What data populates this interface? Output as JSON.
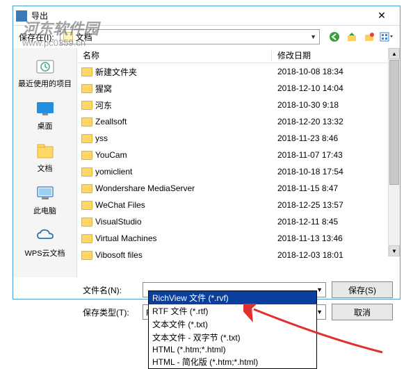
{
  "title": "导出",
  "watermark": {
    "big": "河东软件园",
    "url": "www.pc0359.cn"
  },
  "savein": {
    "label": "保存在(I):",
    "value": "文档"
  },
  "columns": {
    "name": "名称",
    "date": "修改日期"
  },
  "files": [
    {
      "name": "新建文件夹",
      "date": "2018-10-08 18:34"
    },
    {
      "name": "猩窝",
      "date": "2018-12-10 14:04"
    },
    {
      "name": "河东",
      "date": "2018-10-30 9:18"
    },
    {
      "name": "Zeallsoft",
      "date": "2018-12-20 13:32"
    },
    {
      "name": "yss",
      "date": "2018-11-23 8:46"
    },
    {
      "name": "YouCam",
      "date": "2018-11-07 17:43"
    },
    {
      "name": "yomiclient",
      "date": "2018-10-18 17:54"
    },
    {
      "name": "Wondershare MediaServer",
      "date": "2018-11-15 8:47"
    },
    {
      "name": "WeChat Files",
      "date": "2018-12-25 13:57"
    },
    {
      "name": "VisualStudio",
      "date": "2018-12-11 8:45"
    },
    {
      "name": "Virtual Machines",
      "date": "2018-11-13 13:46"
    },
    {
      "name": "Vibosoft files",
      "date": "2018-12-03 18:01"
    }
  ],
  "sidebar": [
    {
      "label": "最近使用的项目"
    },
    {
      "label": "桌面"
    },
    {
      "label": "文档"
    },
    {
      "label": "此电脑"
    },
    {
      "label": "WPS云文档"
    }
  ],
  "filename": {
    "label": "文件名(N):",
    "value": ""
  },
  "filetype": {
    "label": "保存类型(T):",
    "value": "RichView 文件 (*.rvf)"
  },
  "buttons": {
    "save": "保存(S)",
    "cancel": "取消"
  },
  "dropdown": [
    "RichView 文件 (*.rvf)",
    "RTF 文件 (*.rtf)",
    "文本文件 (*.txt)",
    "文本文件 - 双字节 (*.txt)",
    "HTML (*.htm;*.html)",
    "HTML - 简化版 (*.htm;*.html)"
  ],
  "dropdown_selected": 0
}
